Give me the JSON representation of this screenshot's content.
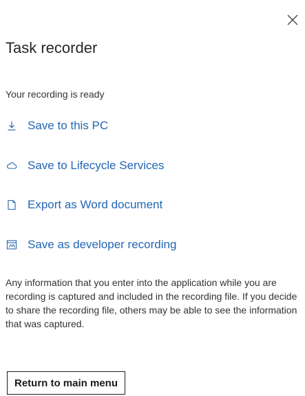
{
  "panel": {
    "close_icon": "close-icon",
    "title": "Task recorder",
    "status": "Your recording is ready",
    "actions": [
      {
        "label": "Save to this PC",
        "icon": "download-icon"
      },
      {
        "label": "Save to Lifecycle Services",
        "icon": "cloud-icon"
      },
      {
        "label": "Export as Word document",
        "icon": "document-icon"
      },
      {
        "label": "Save as developer recording",
        "icon": "developer-recording-icon"
      }
    ],
    "info": "Any information that you enter into the application while you are recording is captured and included in the recording file. If you decide to share the recording file, others may be able to see the information that was captured.",
    "return_button": "Return to main menu"
  },
  "colors": {
    "link": "#2266b5",
    "text": "#262626",
    "border": "#1a1a1a"
  }
}
